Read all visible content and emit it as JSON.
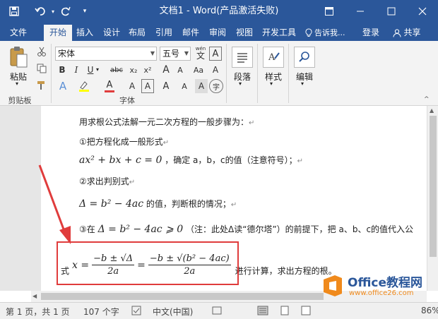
{
  "titlebar": {
    "title": "文档1 - Word(产品激活失败)",
    "qa_save": "save-icon",
    "qa_undo": "undo-icon",
    "qa_redo": "redo-icon",
    "qa_more": "customize-icon"
  },
  "tabs": {
    "items": [
      "文件",
      "开始",
      "插入",
      "设计",
      "布局",
      "引用",
      "邮件",
      "审阅",
      "视图",
      "开发工具"
    ],
    "tell_me": "告诉我...",
    "login": "登录",
    "share": "共享"
  },
  "ribbon": {
    "paste_label": "粘贴",
    "clipboard_label": "剪贴板",
    "font_name": "宋体",
    "font_size": "五号",
    "font_group_label": "字体",
    "wen_label": "wén",
    "bold": "B",
    "italic": "I",
    "underline": "U",
    "strike": "abc",
    "sub": "x₂",
    "sup": "x²",
    "grow": "A",
    "shrink": "A",
    "aa": "Aa",
    "clear": "A",
    "circle": "字",
    "para_label": "段落",
    "style_label": "样式",
    "edit_label": "编辑"
  },
  "doc": {
    "l1": "用求根公式法解一元二次方程的一般步骤为：",
    "l2": "①把方程化成一般形式",
    "l3_math": "ax² + bx + c = 0",
    "l3_text": "，确定 a，b，c的值（注意符号）；",
    "l4": "②求出判别式",
    "l5_math": "Δ = b² − 4ac",
    "l5_text": "的值，判断根的情况；",
    "l6_prefix": "③在",
    "l6_math": "Δ = b² − 4ac ⩾ 0",
    "l6_text": "（注：此处Δ读“德尔塔”）的前提下，把 a、b、c的值代入公",
    "l7_prefix": "式",
    "l7_x": "x =",
    "frac1_num": "−b ± √Δ",
    "frac1_den": "2a",
    "eq": "=",
    "frac2_num": "−b ± √(b² − 4ac)",
    "frac2_den": "2a",
    "l7_text": "进行计算，求出方程的根。"
  },
  "status": {
    "page": "第 1 页，共 1 页",
    "words": "107 个字",
    "lang": "中文(中国)",
    "zoom": "86%"
  },
  "watermark": {
    "brand": "Office教程网",
    "url": "www.office26.com"
  },
  "colors": {
    "brand": "#2b579a",
    "highlight": "#e03c3c",
    "watermark_orange": "#f08a1c"
  }
}
